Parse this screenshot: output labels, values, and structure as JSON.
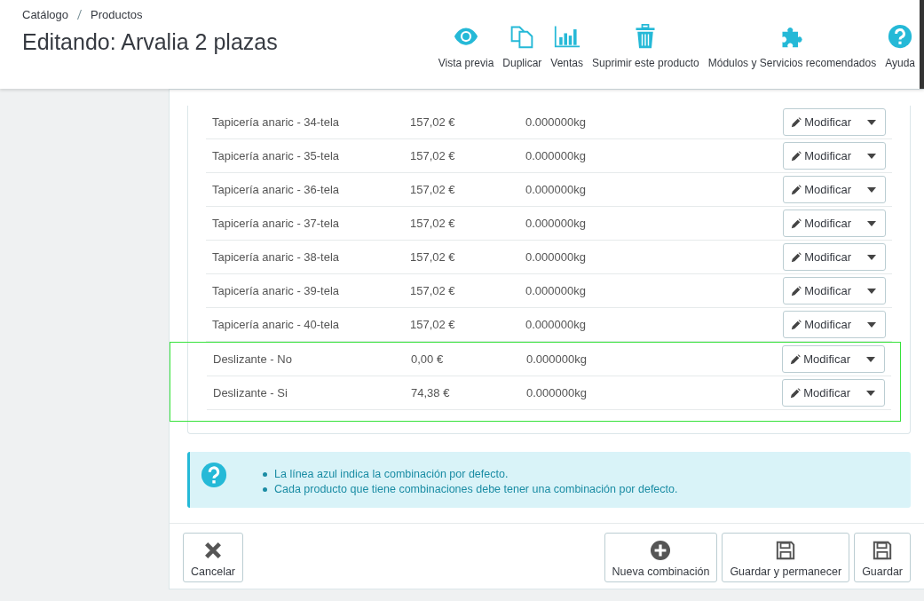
{
  "breadcrumb": [
    {
      "label": "Catálogo"
    },
    {
      "label": "Productos"
    }
  ],
  "title": "Editando: Arvalia 2 plazas",
  "toolbar": [
    {
      "label": "Vista previa"
    },
    {
      "label": "Duplicar"
    },
    {
      "label": "Ventas"
    },
    {
      "label": "Suprimir este producto"
    },
    {
      "label": "Módulos y Servicios recomendados"
    },
    {
      "label": "Ayuda"
    }
  ],
  "combinations": [
    {
      "name": "Tapicería anaric - 34-tela",
      "price": "157,02 €",
      "weight": "0.000000kg",
      "action": "Modificar",
      "highlighted": false
    },
    {
      "name": "Tapicería anaric - 35-tela",
      "price": "157,02 €",
      "weight": "0.000000kg",
      "action": "Modificar",
      "highlighted": false
    },
    {
      "name": "Tapicería anaric - 36-tela",
      "price": "157,02 €",
      "weight": "0.000000kg",
      "action": "Modificar",
      "highlighted": false
    },
    {
      "name": "Tapicería anaric - 37-tela",
      "price": "157,02 €",
      "weight": "0.000000kg",
      "action": "Modificar",
      "highlighted": false
    },
    {
      "name": "Tapicería anaric - 38-tela",
      "price": "157,02 €",
      "weight": "0.000000kg",
      "action": "Modificar",
      "highlighted": false
    },
    {
      "name": "Tapicería anaric - 39-tela",
      "price": "157,02 €",
      "weight": "0.000000kg",
      "action": "Modificar",
      "highlighted": false
    },
    {
      "name": "Tapicería anaric - 40-tela",
      "price": "157,02 €",
      "weight": "0.000000kg",
      "action": "Modificar",
      "highlighted": false
    },
    {
      "name": "Deslizante - No",
      "price": "0,00 €",
      "weight": "0.000000kg",
      "action": "Modificar",
      "highlighted": true
    },
    {
      "name": "Deslizante - Si",
      "price": "74,38 €",
      "weight": "0.000000kg",
      "action": "Modificar",
      "highlighted": true
    }
  ],
  "info": [
    "La línea azul indica la combinación por defecto.",
    "Cada producto que tiene combinaciones debe tener una combinación por defecto."
  ],
  "footer_buttons": [
    {
      "label": "Cancelar"
    },
    {
      "label": "Nueva combinación"
    },
    {
      "label": "Guardar y permanecer"
    },
    {
      "label": "Guardar"
    }
  ]
}
